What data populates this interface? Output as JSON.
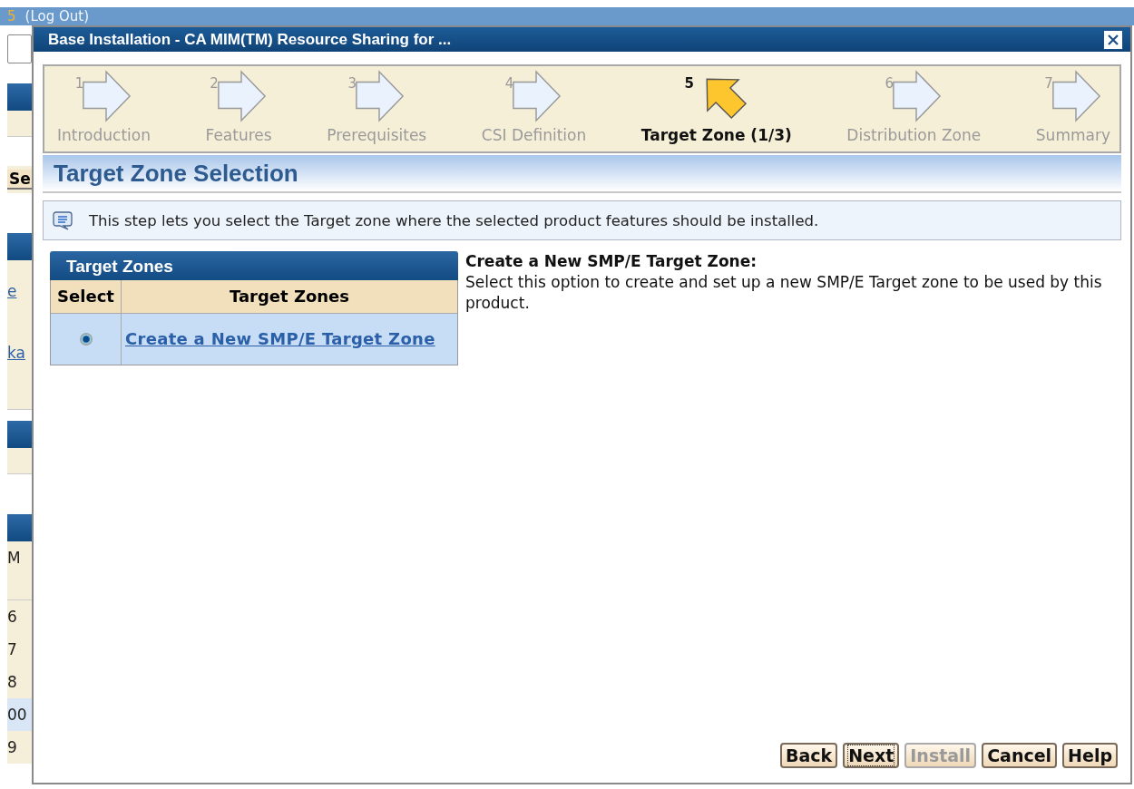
{
  "background_page": {
    "top_bar": {
      "number": "5",
      "link": "(Log Out)"
    },
    "left_strip": [
      {
        "kind": "gap"
      },
      {
        "kind": "field"
      },
      {
        "kind": "gap"
      },
      {
        "kind": "bar"
      },
      {
        "kind": "band"
      },
      {
        "kind": "blank"
      },
      {
        "kind": "button",
        "text": "Se"
      },
      {
        "kind": "blank"
      },
      {
        "kind": "bar"
      },
      {
        "kind": "link",
        "text": "e"
      },
      {
        "kind": "link",
        "text": "ka"
      },
      {
        "kind": "band"
      },
      {
        "kind": "bar"
      },
      {
        "kind": "band"
      },
      {
        "kind": "blank"
      },
      {
        "kind": "bar"
      },
      {
        "kind": "text",
        "text": "M"
      },
      {
        "kind": "band"
      },
      {
        "kind": "text",
        "text": "6"
      },
      {
        "kind": "text",
        "text": "7"
      },
      {
        "kind": "text",
        "text": "8"
      },
      {
        "kind": "highlight",
        "text": "00"
      },
      {
        "kind": "text",
        "text": "9"
      }
    ]
  },
  "window": {
    "title": "Base Installation - CA MIM(TM) Resource Sharing for ..."
  },
  "steps": [
    {
      "number": "1",
      "label": "Introduction",
      "selected": false
    },
    {
      "number": "2",
      "label": "Features",
      "selected": false
    },
    {
      "number": "3",
      "label": "Prerequisites",
      "selected": false
    },
    {
      "number": "4",
      "label": "CSI Definition",
      "selected": false
    },
    {
      "number": "5",
      "label": "Target Zone (1/3)",
      "selected": true
    },
    {
      "number": "6",
      "label": "Distribution Zone",
      "selected": false
    },
    {
      "number": "7",
      "label": "Summary",
      "selected": false
    }
  ],
  "heading": "Target Zone Selection",
  "info": "This step lets you select the Target zone where the selected product features should be installed.",
  "table": {
    "title": "Target Zones",
    "columns": [
      "Select",
      "Target Zones"
    ],
    "rows": [
      {
        "label": "Create a New SMP/E Target Zone",
        "selected": true
      }
    ]
  },
  "description": {
    "title": "Create a New SMP/E Target Zone:",
    "text": "Select this option to create and set up a new SMP/E Target zone to be used by this product."
  },
  "buttons": [
    {
      "label": "Back",
      "disabled": false,
      "focused": false
    },
    {
      "label": "Next",
      "disabled": false,
      "focused": true
    },
    {
      "label": "Install",
      "disabled": true,
      "focused": false
    },
    {
      "label": "Cancel",
      "disabled": false,
      "focused": false
    },
    {
      "label": "Help",
      "disabled": false,
      "focused": false
    }
  ]
}
